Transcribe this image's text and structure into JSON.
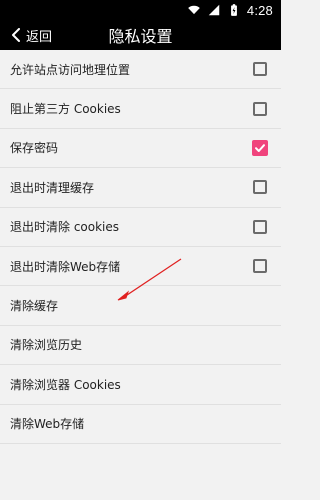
{
  "status_bar": {
    "time": "4:28",
    "icons": [
      "wifi-icon",
      "signal-icon",
      "battery-icon"
    ]
  },
  "app_bar": {
    "back_label": "返回",
    "title": "隐私设置"
  },
  "settings": [
    {
      "label": "允许站点访问地理位置",
      "checkbox": true,
      "checked": false
    },
    {
      "label": "阻止第三方 Cookies",
      "checkbox": true,
      "checked": false
    },
    {
      "label": "保存密码",
      "checkbox": true,
      "checked": true
    },
    {
      "label": "退出时清理缓存",
      "checkbox": true,
      "checked": false
    },
    {
      "label": "退出时清除 cookies",
      "checkbox": true,
      "checked": false
    },
    {
      "label": "退出时清除Web存储",
      "checkbox": true,
      "checked": false
    },
    {
      "label": "清除缓存",
      "checkbox": false
    },
    {
      "label": "清除浏览历史",
      "checkbox": false
    },
    {
      "label": "清除浏览器 Cookies",
      "checkbox": false
    },
    {
      "label": "清除Web存储",
      "checkbox": false
    }
  ],
  "colors": {
    "accent": "#f0447d",
    "annotation_arrow": "#e02020"
  }
}
